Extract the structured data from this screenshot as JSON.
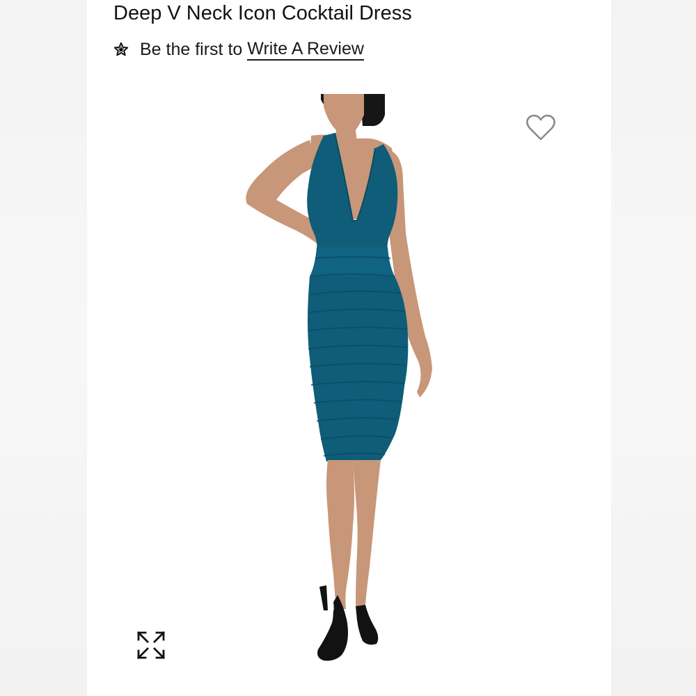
{
  "product": {
    "title": "Deep V Neck Icon Cocktail Dress",
    "review_prompt": "Be the first to",
    "review_link": "Write A Review",
    "image_alt": "Model wearing teal bandage cocktail dress with deep V neck",
    "dress_color": "#0f5d78"
  },
  "icons": {
    "star": "star-icon",
    "wishlist": "heart-outline-icon",
    "expand": "expand-arrows-icon"
  }
}
